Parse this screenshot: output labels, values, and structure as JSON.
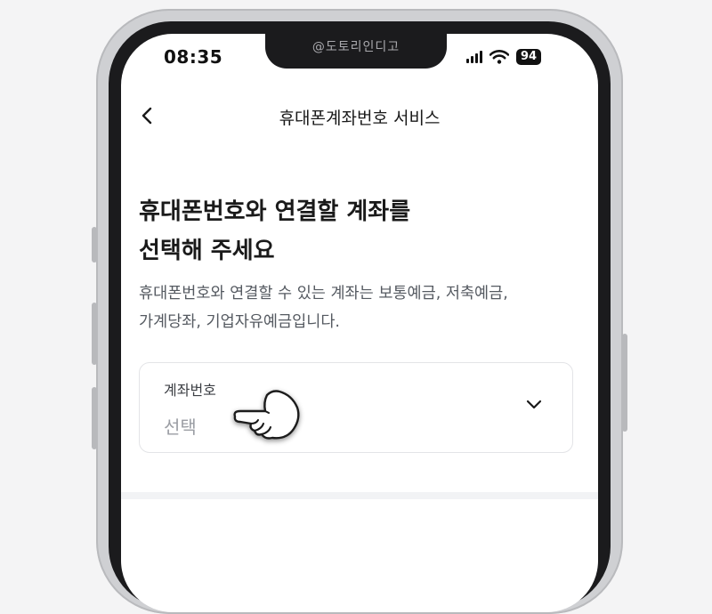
{
  "watermark": "@도토리인디고",
  "status_bar": {
    "time": "08:35",
    "battery": "94",
    "icons": [
      "signal-icon",
      "wifi-icon",
      "battery-icon"
    ]
  },
  "header": {
    "back_icon": "back-chevron-icon",
    "title": "휴대폰계좌번호 서비스"
  },
  "main": {
    "heading_line1": "휴대폰번호와 연결할 계좌를",
    "heading_line2": "선택해 주세요",
    "description_line1": "휴대폰번호와 연결할 수 있는 계좌는 보통예금, 저축예금,",
    "description_line2": "가계당좌, 기업자유예금입니다.",
    "account_field": {
      "label": "계좌번호",
      "value": "선택",
      "icon": "chevron-down-icon"
    }
  },
  "colors": {
    "text_primary": "#1a1a1a",
    "text_secondary": "#555a61",
    "placeholder": "#9a9da3",
    "border": "#e3e4e7"
  }
}
